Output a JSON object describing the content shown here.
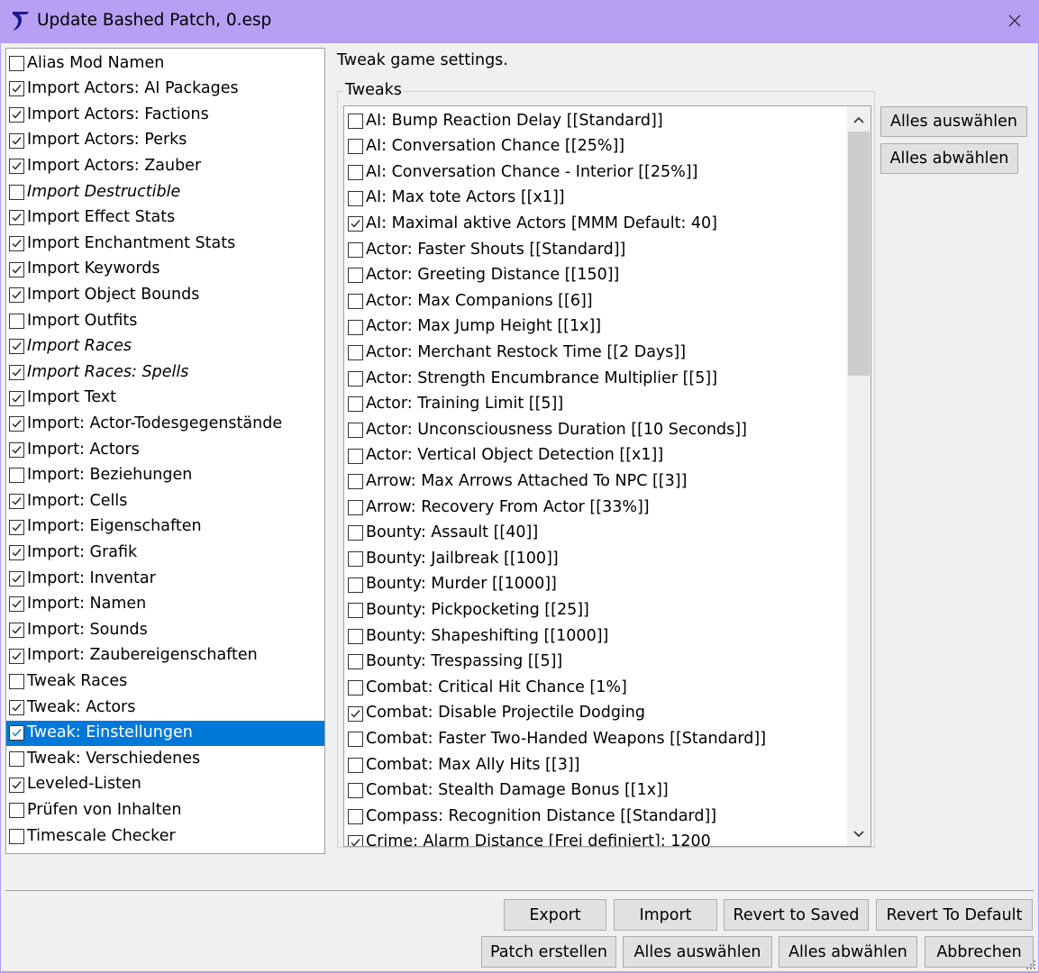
{
  "window": {
    "title": "Update Bashed Patch, 0.esp",
    "icon": "bash-logo-icon",
    "accent_color": "#b79ff4"
  },
  "patchers": [
    {
      "label": "Alias Mod Namen",
      "checked": false,
      "italic": false
    },
    {
      "label": "Import Actors: AI Packages",
      "checked": true,
      "italic": false
    },
    {
      "label": "Import Actors: Factions",
      "checked": true,
      "italic": false
    },
    {
      "label": "Import Actors: Perks",
      "checked": true,
      "italic": false
    },
    {
      "label": "Import Actors: Zauber",
      "checked": true,
      "italic": false
    },
    {
      "label": "Import Destructible",
      "checked": false,
      "italic": true
    },
    {
      "label": "Import Effect Stats",
      "checked": true,
      "italic": false
    },
    {
      "label": "Import Enchantment Stats",
      "checked": true,
      "italic": false
    },
    {
      "label": "Import Keywords",
      "checked": true,
      "italic": false
    },
    {
      "label": "Import Object Bounds",
      "checked": true,
      "italic": false
    },
    {
      "label": "Import Outfits",
      "checked": false,
      "italic": false
    },
    {
      "label": "Import Races",
      "checked": true,
      "italic": true
    },
    {
      "label": "Import Races: Spells",
      "checked": true,
      "italic": true
    },
    {
      "label": "Import Text",
      "checked": true,
      "italic": false
    },
    {
      "label": "Import: Actor-Todesgegenstände",
      "checked": true,
      "italic": false
    },
    {
      "label": "Import: Actors",
      "checked": true,
      "italic": false
    },
    {
      "label": "Import: Beziehungen",
      "checked": false,
      "italic": false
    },
    {
      "label": "Import: Cells",
      "checked": true,
      "italic": false
    },
    {
      "label": "Import: Eigenschaften",
      "checked": true,
      "italic": false
    },
    {
      "label": "Import: Grafik",
      "checked": true,
      "italic": false
    },
    {
      "label": "Import: Inventar",
      "checked": true,
      "italic": false
    },
    {
      "label": "Import: Namen",
      "checked": true,
      "italic": false
    },
    {
      "label": "Import: Sounds",
      "checked": true,
      "italic": false
    },
    {
      "label": "Import: Zaubereigenschaften",
      "checked": true,
      "italic": false
    },
    {
      "label": "Tweak Races",
      "checked": false,
      "italic": false
    },
    {
      "label": "Tweak: Actors",
      "checked": true,
      "italic": false
    },
    {
      "label": "Tweak: Einstellungen",
      "checked": true,
      "italic": false,
      "selected": true
    },
    {
      "label": "Tweak: Verschiedenes",
      "checked": false,
      "italic": false
    },
    {
      "label": "Leveled-Listen",
      "checked": true,
      "italic": false
    },
    {
      "label": "Prüfen von Inhalten",
      "checked": false,
      "italic": false
    },
    {
      "label": "Timescale Checker",
      "checked": false,
      "italic": false
    }
  ],
  "details": {
    "description": "Tweak game settings.",
    "group_label": "Tweaks",
    "select_all_label": "Alles auswählen",
    "deselect_all_label": "Alles abwählen"
  },
  "tweaks": [
    {
      "label": "AI: Bump Reaction Delay [[Standard]]",
      "checked": false
    },
    {
      "label": "AI: Conversation Chance [[25%]]",
      "checked": false
    },
    {
      "label": "AI: Conversation Chance - Interior [[25%]]",
      "checked": false
    },
    {
      "label": "AI: Max tote Actors [[x1]]",
      "checked": false
    },
    {
      "label": "AI: Maximal aktive Actors [MMM Default: 40]",
      "checked": true
    },
    {
      "label": "Actor: Faster Shouts [[Standard]]",
      "checked": false
    },
    {
      "label": "Actor: Greeting Distance [[150]]",
      "checked": false
    },
    {
      "label": "Actor: Max Companions [[6]]",
      "checked": false
    },
    {
      "label": "Actor: Max Jump Height [[1x]]",
      "checked": false
    },
    {
      "label": "Actor: Merchant Restock Time [[2 Days]]",
      "checked": false
    },
    {
      "label": "Actor: Strength Encumbrance Multiplier [[5]]",
      "checked": false
    },
    {
      "label": "Actor: Training Limit [[5]]",
      "checked": false
    },
    {
      "label": "Actor: Unconsciousness Duration [[10 Seconds]]",
      "checked": false
    },
    {
      "label": "Actor: Vertical Object Detection [[x1]]",
      "checked": false
    },
    {
      "label": "Arrow: Max Arrows Attached To NPC [[3]]",
      "checked": false
    },
    {
      "label": "Arrow: Recovery From Actor [[33%]]",
      "checked": false
    },
    {
      "label": "Bounty: Assault [[40]]",
      "checked": false
    },
    {
      "label": "Bounty: Jailbreak [[100]]",
      "checked": false
    },
    {
      "label": "Bounty: Murder [[1000]]",
      "checked": false
    },
    {
      "label": "Bounty: Pickpocketing [[25]]",
      "checked": false
    },
    {
      "label": "Bounty: Shapeshifting [[1000]]",
      "checked": false
    },
    {
      "label": "Bounty: Trespassing [[5]]",
      "checked": false
    },
    {
      "label": "Combat: Critical Hit Chance [1%]",
      "checked": false
    },
    {
      "label": "Combat: Disable Projectile Dodging",
      "checked": true
    },
    {
      "label": "Combat: Faster Two-Handed Weapons [[Standard]]",
      "checked": false
    },
    {
      "label": "Combat: Max Ally Hits [[3]]",
      "checked": false
    },
    {
      "label": "Combat: Stealth Damage Bonus [[1x]]",
      "checked": false
    },
    {
      "label": "Compass: Recognition Distance [[Standard]]",
      "checked": false
    },
    {
      "label": "Crime: Alarm Distance [Frei definiert]: 1200",
      "checked": true
    }
  ],
  "footer": {
    "export_label": "Export",
    "import_label": "Import",
    "revert_saved_label": "Revert to Saved",
    "revert_default_label": "Revert To Default",
    "build_patch_label": "Patch erstellen",
    "select_all_label": "Alles auswählen",
    "deselect_all_label": "Alles abwählen",
    "cancel_label": "Abbrechen"
  }
}
